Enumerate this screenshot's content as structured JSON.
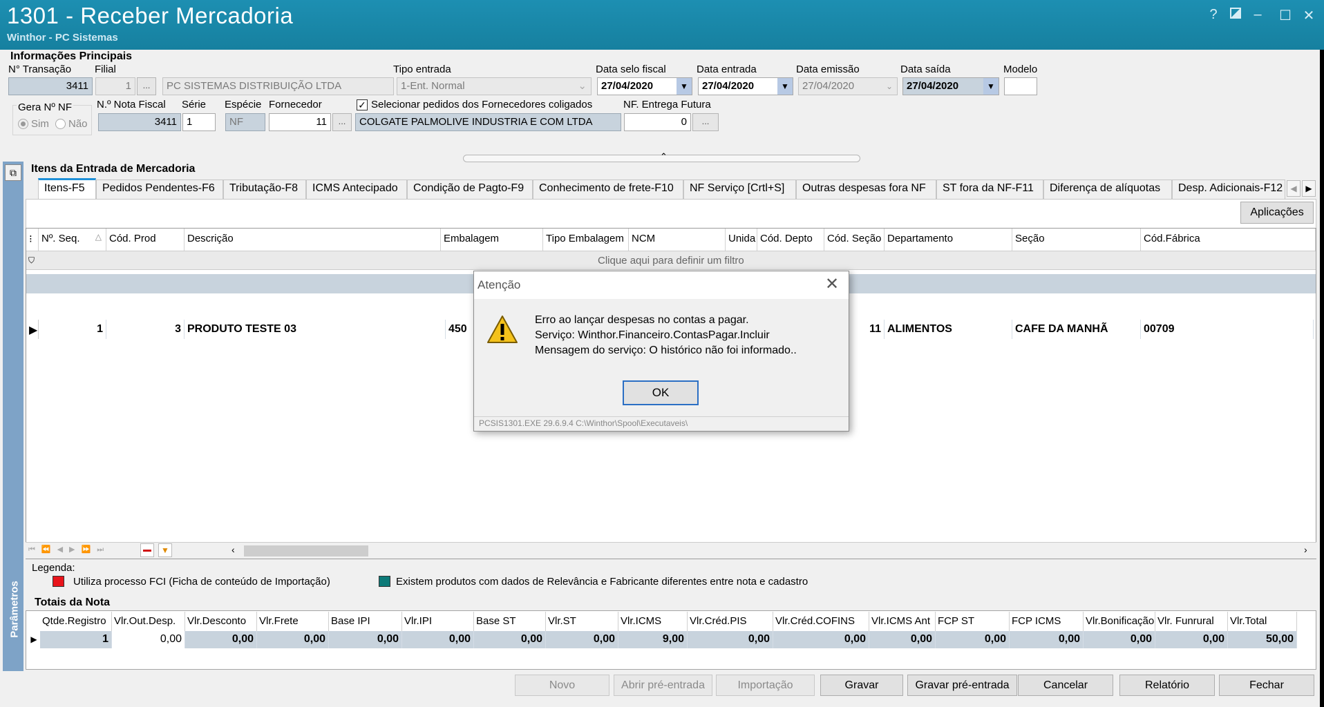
{
  "window": {
    "title": "1301 - Receber Mercadoria",
    "subtitle": "Winthor - PC Sistemas",
    "help_glyph": "?",
    "minimize_glyph": "–",
    "maximize_glyph": "☐",
    "close_glyph": "✕"
  },
  "info": {
    "section_title": "Informações Principais",
    "transacao_label": "N° Transação",
    "transacao_value": "3411",
    "filial_label": "Filial",
    "filial_code": "1",
    "filial_name": "PC SISTEMAS DISTRIBUIÇÃO LTDA",
    "tipo_entrada_label": "Tipo entrada",
    "tipo_entrada_value": "1-Ent. Normal",
    "data_selo_label": "Data selo fiscal",
    "data_selo_value": "27/04/2020",
    "data_entrada_label": "Data entrada",
    "data_entrada_value": "27/04/2020",
    "data_emissao_label": "Data emissão",
    "data_emissao_value": "27/04/2020",
    "data_saida_label": "Data saída",
    "data_saida_value": "27/04/2020",
    "modelo_label": "Modelo",
    "modelo_value": "",
    "gera_nf_label": "Gera Nº NF",
    "sim_label": "Sim",
    "nao_label": "Não",
    "nota_fiscal_label": "N.º Nota Fiscal",
    "nota_fiscal_value": "3411",
    "serie_label": "Série",
    "serie_value": "1",
    "especie_label": "Espécie",
    "especie_value": "NF",
    "fornecedor_label": "Fornecedor",
    "fornecedor_code": "11",
    "fornecedor_name": "COLGATE PALMOLIVE INDUSTRIA  E COM LTDA",
    "coligados_label": "Selecionar pedidos dos Fornecedores coligados",
    "entrega_futura_label": "NF. Entrega Futura",
    "entrega_futura_value": "0",
    "ellipsis": "..."
  },
  "items": {
    "section_title": "Itens da Entrada de Mercadoria",
    "tabs": [
      "Itens-F5",
      "Pedidos Pendentes-F6",
      "Tributação-F8",
      "ICMS Antecipado",
      "Condição de Pagto-F9",
      "Conhecimento de frete-F10",
      "NF Serviço [Crtl+S]",
      "Outras despesas fora NF",
      "ST fora da NF-F11",
      "Diferença de alíquotas",
      "Desp. Adicionais-F12"
    ],
    "aplicacoes_label": "Aplicações",
    "columns": [
      "Nº. Seq.",
      "Cód. Prod",
      "Descrição",
      "Embalagem",
      "Tipo Embalagem",
      "NCM",
      "Unida",
      "Cód. Depto",
      "Cód. Seção",
      "Departamento",
      "Seção",
      "Cód.Fábrica"
    ],
    "filter_hint": "Clique aqui para definir um filtro",
    "row": {
      "seq": "1",
      "cod_prod": "3",
      "descricao": "PRODUTO TESTE 03",
      "embalagem": "450",
      "cod_secao": "11",
      "departamento": "ALIMENTOS",
      "secao": "CAFE DA MANHÃ",
      "cod_fabrica": "00709"
    }
  },
  "legend": {
    "title": "Legenda:",
    "item1_color": "#e8141b",
    "item1_label": "Utiliza processo FCI (Ficha de conteúdo de Importação)",
    "item2_color": "#0d7a78",
    "item2_label": "Existem produtos com dados de Relevância e Fabricante diferentes entre nota e cadastro"
  },
  "totals": {
    "section_title": "Totais da Nota",
    "side_label": "Parâmetros",
    "columns": [
      "Qtde.Registro",
      "Vlr.Out.Desp.",
      "Vlr.Desconto",
      "Vlr.Frete",
      "Base IPI",
      "Vlr.IPI",
      "Base ST",
      "Vlr.ST",
      "Vlr.ICMS",
      "Vlr.Créd.PIS",
      "Vlr.Créd.COFINS",
      "Vlr.ICMS Ant",
      "FCP ST",
      "FCP ICMS",
      "Vlr.Bonificação",
      "Vlr. Funrural",
      "Vlr.Total"
    ],
    "values": [
      "1",
      "0,00",
      "0,00",
      "0,00",
      "0,00",
      "0,00",
      "0,00",
      "0,00",
      "9,00",
      "0,00",
      "0,00",
      "0,00",
      "0,00",
      "0,00",
      "0,00",
      "0,00",
      "50,00"
    ]
  },
  "buttons": {
    "novo": "Novo",
    "abrir_pre_entrada": "Abrir pré-entrada",
    "importacao": "Importação",
    "gravar": "Gravar",
    "gravar_pre_entrada": "Gravar pré-entrada",
    "cancelar": "Cancelar",
    "relatorio": "Relatório",
    "fechar": "Fechar"
  },
  "dialog": {
    "title": "Atenção",
    "line1": "Erro ao lançar despesas no contas a pagar.",
    "line2": "Serviço: Winthor.Financeiro.ContasPagar.Incluir",
    "line3": "Mensagem do serviço: O histórico não foi informado..",
    "ok_label": "OK",
    "footer": "PCSIS1301.EXE 29.6.9.4 C:\\Winthor\\Spool\\Executaveis\\",
    "icon": "warning-icon"
  }
}
